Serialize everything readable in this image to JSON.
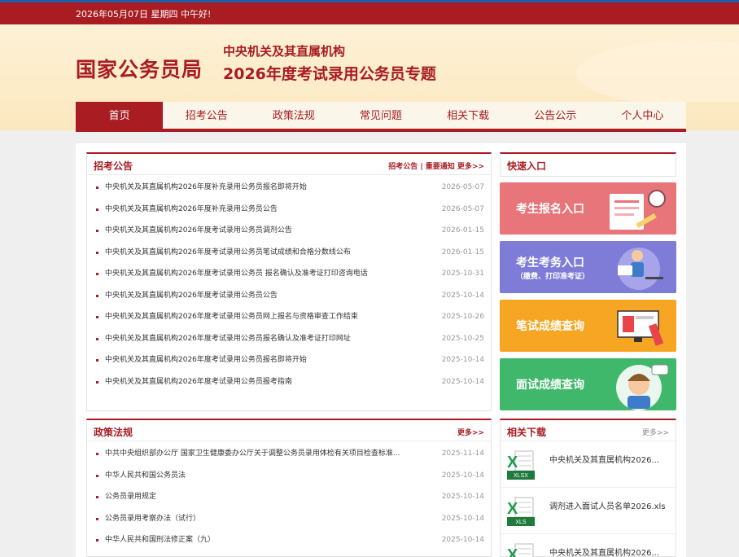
{
  "topbar": {
    "date": "2026年05月07日  星期四  中午好!"
  },
  "banner": {
    "logo": "国家公务员局",
    "sub1": "中央机关及其直属机构",
    "sub2": "2026年度考试录用公务员专题"
  },
  "nav": [
    "首页",
    "招考公告",
    "政策法规",
    "常见问题",
    "相关下载",
    "公告公示",
    "个人中心"
  ],
  "announce": {
    "title": "招考公告",
    "right": "招考公告 | 重要通知   更多>>",
    "items": [
      {
        "t": "中央机关及其直属机构2026年度补充录用公务员报名即将开始",
        "d": "2026-05-07"
      },
      {
        "t": "中央机关及其直属机构2026年度补充录用公务员公告",
        "d": "2026-05-07"
      },
      {
        "t": "中央机关及其直属机构2026年度考试录用公务员调剂公告",
        "d": "2026-01-15"
      },
      {
        "t": "中央机关及其直属机构2026年度考试录用公务员笔试成绩和合格分数线公布",
        "d": "2026-01-15"
      },
      {
        "t": "中央机关及其直属机构2026年度考试录用公务员 报名确认及准考证打印咨询电话",
        "d": "2025-10-31"
      },
      {
        "t": "中央机关及其直属机构2026年度考试录用公务员公告",
        "d": "2025-10-14"
      },
      {
        "t": "中央机关及其直属机构2026年度考试录用公务员网上报名与资格审查工作结束",
        "d": "2025-10-26"
      },
      {
        "t": "中央机关及其直属机构2026年度考试录用公务员报名确认及准考证打印网址",
        "d": "2025-10-25"
      },
      {
        "t": "中央机关及其直属机构2026年度考试录用公务员报名即将开始",
        "d": "2025-10-14"
      },
      {
        "t": "中央机关及其直属机构2026年度考试录用公务员报考指南",
        "d": "2025-10-14"
      }
    ]
  },
  "policy": {
    "title": "政策法规",
    "right": "更多>>",
    "items": [
      {
        "t": "中共中央组织部办公厅 国家卫生健康委办公厅关于调整公务员录用体检有关项目检查标准...",
        "d": "2025-11-14"
      },
      {
        "t": "中华人民共和国公务员法",
        "d": "2025-10-14"
      },
      {
        "t": "公务员录用规定",
        "d": "2025-10-14"
      },
      {
        "t": "公务员录用考察办法（试行）",
        "d": "2025-10-14"
      },
      {
        "t": "中华人民共和国刑法修正案（九）",
        "d": "2025-10-14"
      }
    ]
  },
  "quick": {
    "title": "快速入口",
    "buttons": [
      {
        "label": "考生报名入口",
        "sub": "",
        "color": "#e8757a"
      },
      {
        "label": "考生考务入口",
        "sub": "（缴费、打印准考证）",
        "color": "#7f7cd8"
      },
      {
        "label": "笔试成绩查询",
        "sub": "",
        "color": "#f6a623"
      },
      {
        "label": "面试成绩查询",
        "sub": "",
        "color": "#3fb86b"
      }
    ]
  },
  "downloads": {
    "title": "相关下载",
    "right": "更多>>",
    "items": [
      {
        "name": "中央机关及其直属机构2026...",
        "ext": "XLSX"
      },
      {
        "name": "调剂进入面试人员名单2026.xls",
        "ext": "XLS"
      },
      {
        "name": "中央机关及其直属机构2026...",
        "ext": ""
      }
    ]
  },
  "colors": {
    "brand": "#a81c22",
    "topStripe": "#1d5fa8"
  }
}
